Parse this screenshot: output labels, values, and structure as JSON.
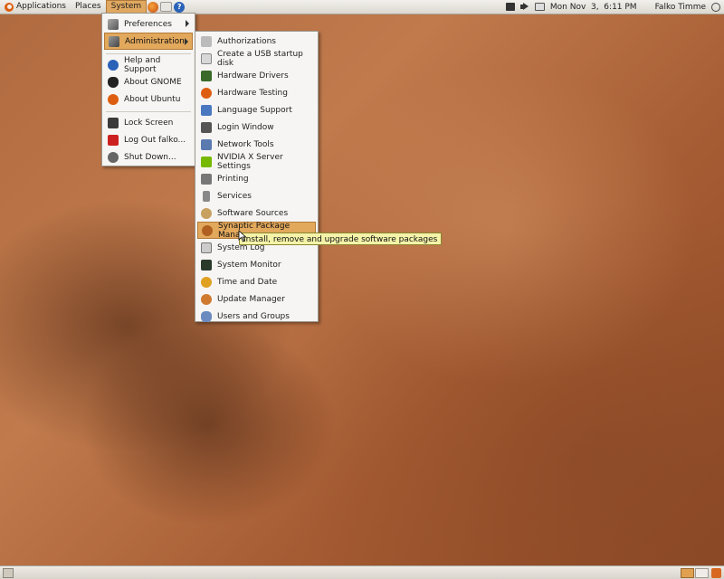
{
  "top_panel": {
    "menus": [
      "Applications",
      "Places",
      "System"
    ],
    "active_menu": "System",
    "clock": "Mon Nov  3,  6:11 PM",
    "user": "Falko Timme"
  },
  "system_menu": {
    "items": [
      {
        "label": "Preferences",
        "icon": "preferences-icon",
        "submenu": true
      },
      {
        "label": "Administration",
        "icon": "administration-icon",
        "submenu": true
      },
      {
        "label": "Help and Support",
        "icon": "help-icon"
      },
      {
        "label": "About GNOME",
        "icon": "gnome-foot-icon"
      },
      {
        "label": "About Ubuntu",
        "icon": "ubuntu-icon"
      },
      {
        "label": "Lock Screen",
        "icon": "lock-screen-icon"
      },
      {
        "label": "Log Out falko...",
        "icon": "log-out-icon"
      },
      {
        "label": "Shut Down...",
        "icon": "shutdown-icon"
      }
    ]
  },
  "admin_menu": {
    "items": [
      "Authorizations",
      "Create a USB startup disk",
      "Hardware Drivers",
      "Hardware Testing",
      "Language Support",
      "Login Window",
      "Network Tools",
      "NVIDIA X Server Settings",
      "Printing",
      "Services",
      "Software Sources",
      "Synaptic Package Manager",
      "System Log",
      "System Monitor",
      "Time and Date",
      "Update Manager",
      "Users and Groups"
    ],
    "highlighted": "Synaptic Package Manager"
  },
  "tooltip": "Install, remove and upgrade software packages",
  "colors": {
    "highlight": "#e2a85c",
    "tooltip_bg": "#f5f3a8",
    "panel_bg": "#e8e5df"
  }
}
